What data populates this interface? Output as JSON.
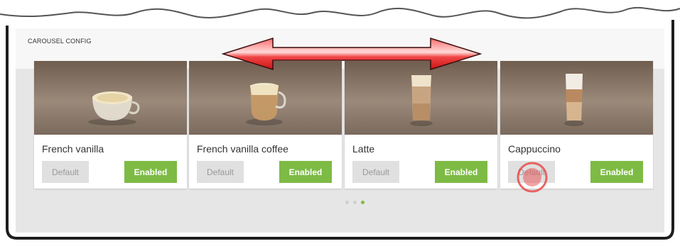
{
  "section": {
    "title": "CAROUSEL CONFIG"
  },
  "cards": [
    {
      "name": "French vanilla",
      "default_label": "Default",
      "enabled_label": "Enabled",
      "drink": "cup-light"
    },
    {
      "name": "French vanilla coffee",
      "default_label": "Default",
      "enabled_label": "Enabled",
      "drink": "glass-mug"
    },
    {
      "name": "Latte",
      "default_label": "Default",
      "enabled_label": "Enabled",
      "drink": "tall-glass"
    },
    {
      "name": "Cappuccino",
      "default_label": "Default",
      "enabled_label": "Enabled",
      "drink": "layered-glass"
    }
  ],
  "pagination": {
    "pages": 3,
    "active": 3
  },
  "colors": {
    "accent": "#7dbb45",
    "arrow": "#e32222",
    "card_image_bg": "#8b7867"
  }
}
